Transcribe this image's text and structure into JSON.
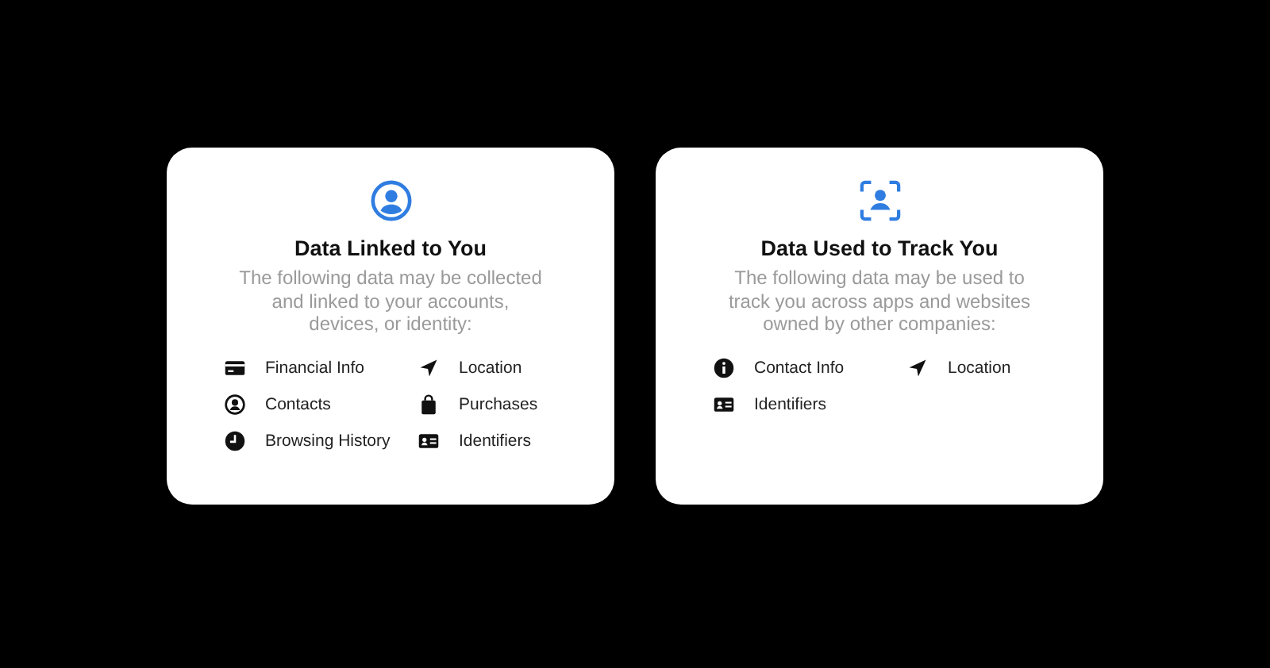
{
  "cards": [
    {
      "kind": "linked",
      "title": "Data Linked to You",
      "description": "The following data may be collected and linked to your accounts, devices, or identity:",
      "items": [
        {
          "label": "Financial Info",
          "kind": "card"
        },
        {
          "label": "Location",
          "kind": "location"
        },
        {
          "label": "Contacts",
          "kind": "contact"
        },
        {
          "label": "Purchases",
          "kind": "bag"
        },
        {
          "label": "Browsing History",
          "kind": "clock"
        },
        {
          "label": "Identifiers",
          "kind": "id"
        }
      ]
    },
    {
      "kind": "tracking",
      "title": "Data Used to Track You",
      "description": "The following data may be used to track you across apps and websites owned by other companies:",
      "items": [
        {
          "label": "Contact Info",
          "kind": "info"
        },
        {
          "label": "Location",
          "kind": "location"
        },
        {
          "label": "Identifiers",
          "kind": "id"
        }
      ]
    }
  ]
}
